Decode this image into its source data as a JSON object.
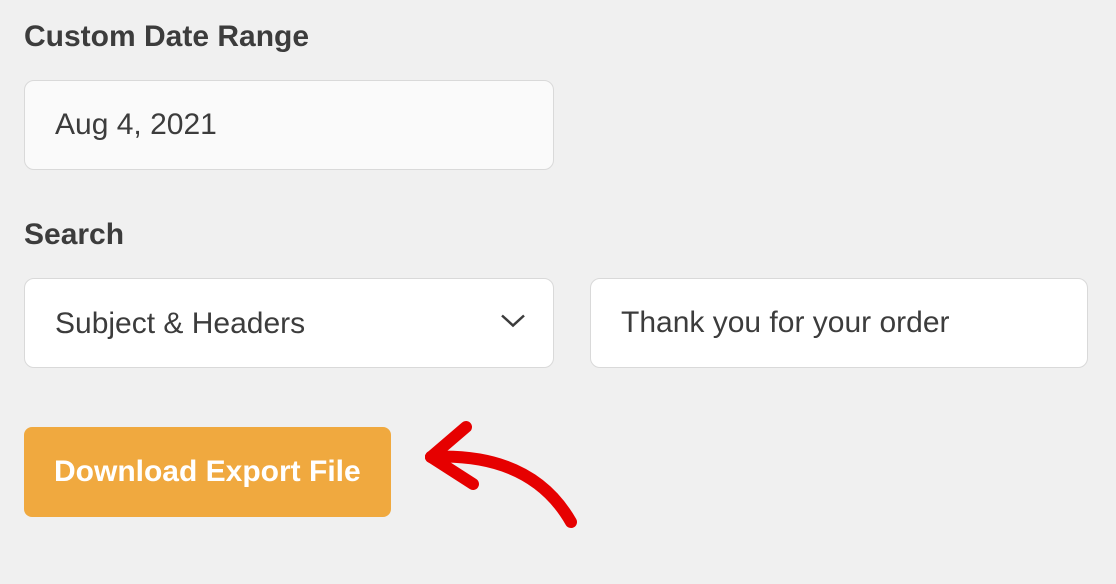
{
  "dateRange": {
    "label": "Custom Date Range",
    "value": "Aug 4, 2021"
  },
  "search": {
    "label": "Search",
    "field": {
      "selected": "Subject & Headers"
    },
    "query": {
      "value": "Thank you for your order"
    }
  },
  "download": {
    "label": "Download Export File"
  }
}
